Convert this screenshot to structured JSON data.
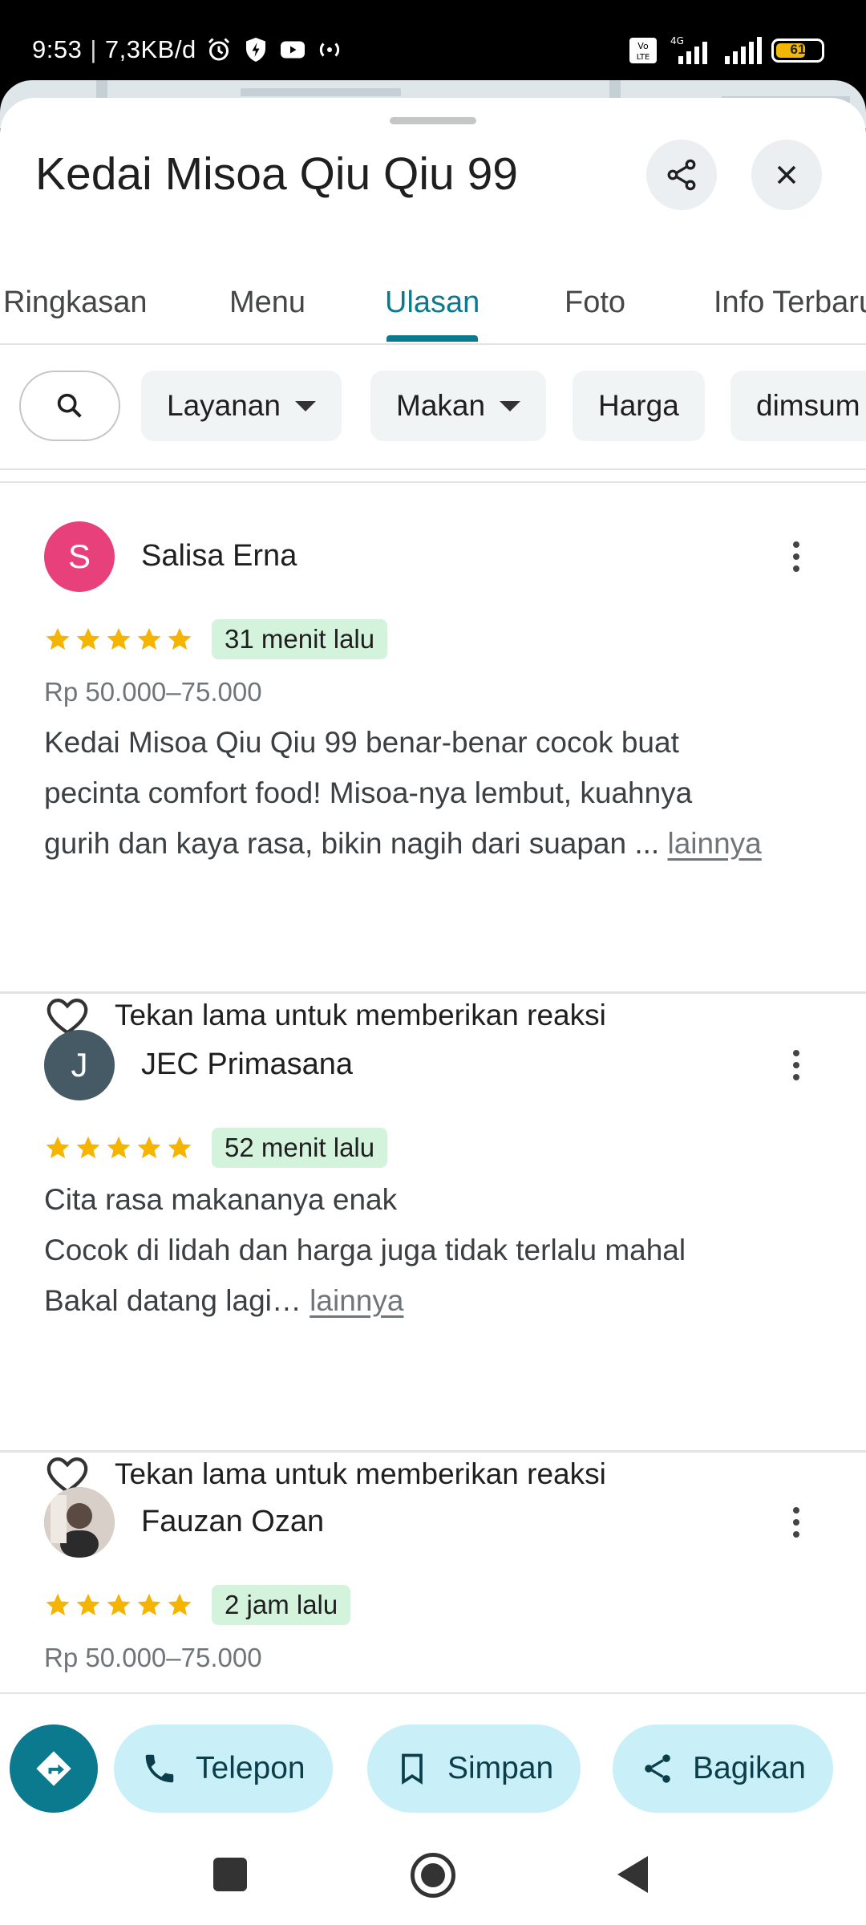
{
  "status_bar": {
    "time": "9:53",
    "separator": "|",
    "net_speed": "7,3KB/d",
    "network_small": "4G",
    "volte": "Vo LTE",
    "battery_level": "61"
  },
  "place": {
    "title": "Kedai Misoa Qiu Qiu 99"
  },
  "tabs": [
    {
      "label": "Ringkasan",
      "active": false
    },
    {
      "label": "Menu",
      "active": false
    },
    {
      "label": "Ulasan",
      "active": true
    },
    {
      "label": "Foto",
      "active": false
    },
    {
      "label": "Info Terbaru",
      "active": false
    }
  ],
  "filters": {
    "search_icon": "search-icon",
    "chips": [
      {
        "label": "Layanan",
        "dropdown": true
      },
      {
        "label": "Makan",
        "dropdown": true
      },
      {
        "label": "Harga",
        "dropdown": false
      },
      {
        "label": "dimsum",
        "dropdown": false
      }
    ]
  },
  "reviews": [
    {
      "avatar_letter": "S",
      "avatar_color": "#e8407a",
      "name": "Salisa Erna",
      "rating": 5,
      "time": "31 menit lalu",
      "price": "Rp 50.000–75.000",
      "lines": [
        "Kedai Misoa Qiu Qiu 99 benar-benar cocok buat",
        "pecinta comfort food! Misoa-nya lembut, kuahnya",
        "gurih dan kaya rasa, bikin nagih dari suapan ...  "
      ],
      "more": "lainnya",
      "reaction": "Tekan lama untuk memberikan reaksi"
    },
    {
      "avatar_letter": "J",
      "avatar_color": "#455a64",
      "name": "JEC Primasana",
      "rating": 5,
      "time": "52 menit lalu",
      "price": "",
      "lines": [
        "Cita rasa makananya enak",
        "Cocok di lidah dan harga juga tidak terlalu mahal",
        "Bakal datang lagi…  "
      ],
      "more": "lainnya",
      "reaction": "Tekan lama untuk memberikan reaksi"
    },
    {
      "avatar_letter": "",
      "avatar_color": "#b9a89a",
      "name": "Fauzan Ozan",
      "rating": 5,
      "time": "2 jam lalu",
      "price": "Rp 50.000–75.000",
      "lines": [],
      "more": "",
      "reaction": ""
    }
  ],
  "actions": {
    "directions_icon": "directions-icon",
    "call": "Telepon",
    "save": "Simpan",
    "share": "Bagikan"
  },
  "colors": {
    "accent": "#0b7a8f",
    "star": "#f4b400",
    "time_badge": "#d4f3dd",
    "action_pill": "#c9f0f8"
  }
}
